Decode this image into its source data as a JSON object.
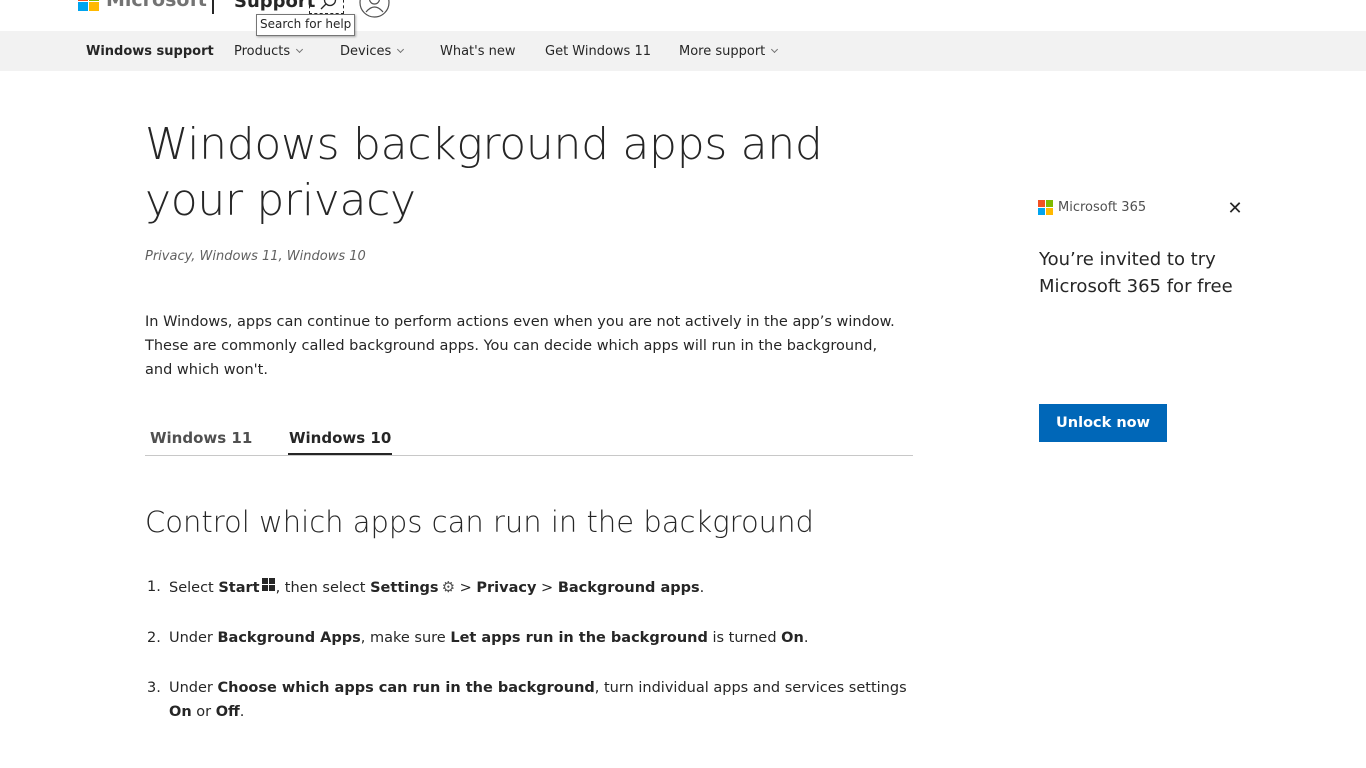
{
  "header": {
    "brand": "Microsoft",
    "section": "Support",
    "search_tooltip": "Search for help",
    "colors": {
      "logo_red": "#f25022",
      "logo_green": "#7fba00",
      "logo_blue": "#00a4ef",
      "logo_yellow": "#ffb900"
    }
  },
  "nav": {
    "home": "Windows support",
    "items": [
      {
        "label": "Products",
        "has_dropdown": true
      },
      {
        "label": "Devices",
        "has_dropdown": true
      },
      {
        "label": "What's new",
        "has_dropdown": false
      },
      {
        "label": "Get Windows 11",
        "has_dropdown": false
      },
      {
        "label": "More support",
        "has_dropdown": true
      }
    ]
  },
  "article": {
    "title": "Windows background apps and your privacy",
    "applies_to": "Privacy, Windows 11, Windows 10",
    "intro": "In Windows, apps can continue to perform actions even when you are not actively in the app’s window. These are commonly called background apps. You can decide which apps will run in the background, and which won't.",
    "tabs": [
      {
        "label": "Windows 11",
        "selected": false
      },
      {
        "label": "Windows 10",
        "selected": true
      }
    ],
    "section_heading": "Control which apps can run in the background",
    "steps": [
      {
        "num": "1.",
        "t1": "Select ",
        "b1": "Start",
        "t2": ", then select ",
        "b2": "Settings",
        "t3": " > ",
        "b3": "Privacy",
        "t4": " > ",
        "b4": "Background apps",
        "t5": "."
      },
      {
        "num": "2.",
        "t1": "Under ",
        "b1": "Background Apps",
        "t2": ", make sure ",
        "b2": "Let apps run in the background",
        "t3": " is turned ",
        "b3": "On",
        "t4": "."
      },
      {
        "num": "3.",
        "t1": "Under ",
        "b1": "Choose which apps can run in the background",
        "t2": ", turn individual apps and services settings ",
        "b2": "On",
        "t3": " or ",
        "b3": "Off",
        "t4": "."
      }
    ]
  },
  "promo": {
    "brand": "Microsoft 365",
    "text": "You’re invited to try Microsoft 365 for free",
    "button_label": "Unlock now",
    "close_glyph": "✕",
    "accent_color": "#0067b8"
  }
}
